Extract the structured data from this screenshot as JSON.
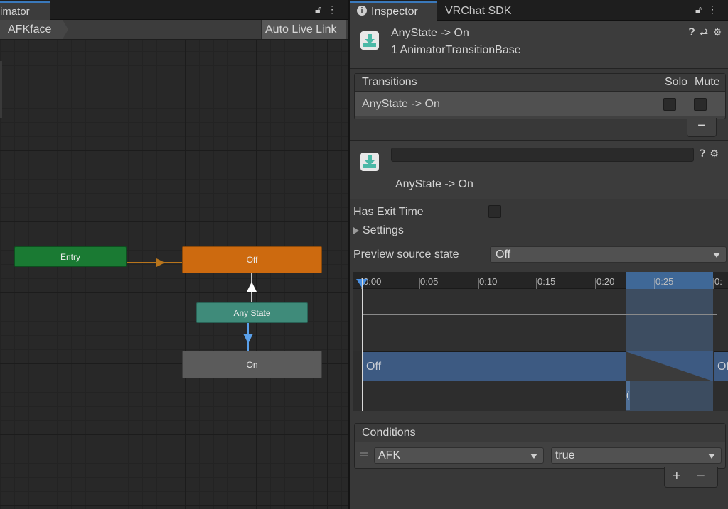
{
  "animator": {
    "tab_title": "imator",
    "breadcrumb": "AFKface",
    "auto_live_link": "Auto Live Link",
    "nodes": {
      "entry": "Entry",
      "off": "Off",
      "any_state": "Any State",
      "on": "On"
    },
    "colors": {
      "entry": "#1a7a33",
      "off": "#cd6a0f",
      "any_state": "#3f8b7a",
      "on": "#5b5b5b",
      "default_transition": "#b8751c",
      "selected_transition": "#5aa0ea"
    }
  },
  "inspector": {
    "tabs": [
      "Inspector",
      "VRChat SDK"
    ],
    "header": {
      "title": "AnyState -> On",
      "subtitle": "1 AnimatorTransitionBase"
    },
    "transitions": {
      "header": "Transitions",
      "solo": "Solo",
      "mute": "Mute",
      "rows": [
        {
          "label": "AnyState -> On",
          "solo": false,
          "mute": false
        }
      ],
      "remove_label": "−"
    },
    "transition_header": {
      "name_value": "",
      "label": "AnyState -> On"
    },
    "has_exit_time": {
      "label": "Has Exit Time",
      "checked": false
    },
    "settings_label": "Settings",
    "preview_source": {
      "label": "Preview source state",
      "value": "Off"
    },
    "timeline": {
      "ticks": [
        "0:00",
        "0:05",
        "0:10",
        "0:15",
        "0:20",
        "0:25",
        "0:"
      ],
      "state_bar": "Off",
      "state_bar_next": "Of",
      "marker_glyph": "("
    },
    "conditions": {
      "header": "Conditions",
      "items": [
        {
          "parameter": "AFK",
          "value": "true"
        }
      ],
      "add_label": "+",
      "remove_label": "−"
    }
  }
}
